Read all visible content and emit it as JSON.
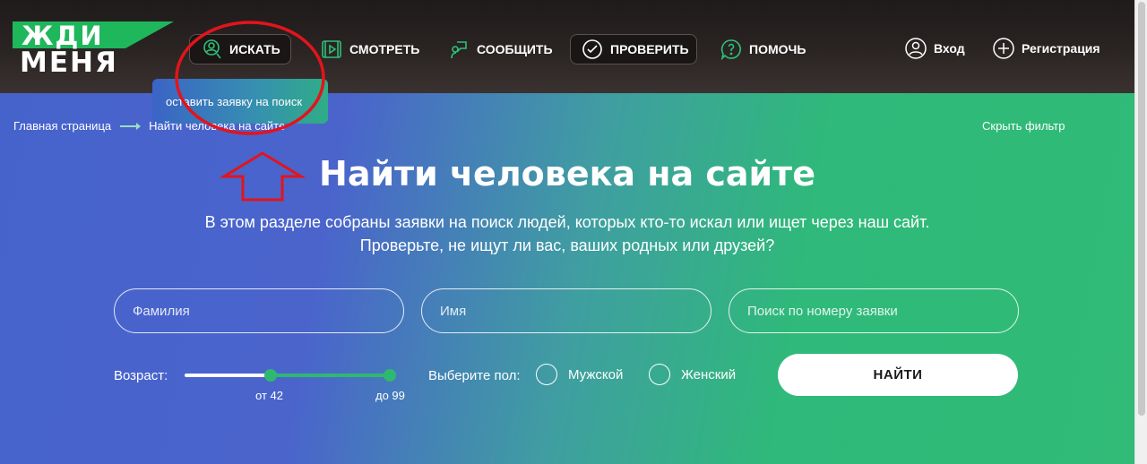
{
  "header": {
    "logo": {
      "line1": "ЖДИ",
      "line2": "МЕНЯ"
    },
    "nav": [
      {
        "label": "ИСКАТЬ",
        "icon": "search-person-icon"
      },
      {
        "label": "СМОТРЕТЬ",
        "icon": "video-icon"
      },
      {
        "label": "СООБЩИТЬ",
        "icon": "speech-person-icon"
      },
      {
        "label": "ПРОВЕРИТЬ",
        "icon": "check-circle-icon"
      },
      {
        "label": "ПОМОЧЬ",
        "icon": "question-bubble-icon"
      }
    ],
    "login_label": "Вход",
    "register_label": "Регистрация"
  },
  "dropdown": {
    "item": "оставить заявку на поиск"
  },
  "breadcrumb": {
    "home": "Главная страница",
    "current": "Найти человека на сайте"
  },
  "filter": {
    "hide_label": "Скрыть фильтр"
  },
  "main": {
    "title": "Найти человека на сайте",
    "subtitle_line1": "В этом разделе собраны заявки на поиск людей, которых кто-то искал или ищет через наш сайт.",
    "subtitle_line2": "Проверьте, не ищут ли вас, ваших родных или друзей?"
  },
  "search": {
    "surname_placeholder": "Фамилия",
    "name_placeholder": "Имя",
    "request_placeholder": "Поиск по номеру заявки",
    "age_label": "Возраст:",
    "age_from": "от 42",
    "age_to": "до 99",
    "gender_label": "Выберите пол:",
    "male_label": "Мужской",
    "female_label": "Женский",
    "find_button": "НАЙТИ"
  },
  "colors": {
    "brand_green": "#1fb75b",
    "gradient_blue": "#4663cc",
    "gradient_green": "#31bb77",
    "annotation_red": "#e3141b"
  }
}
